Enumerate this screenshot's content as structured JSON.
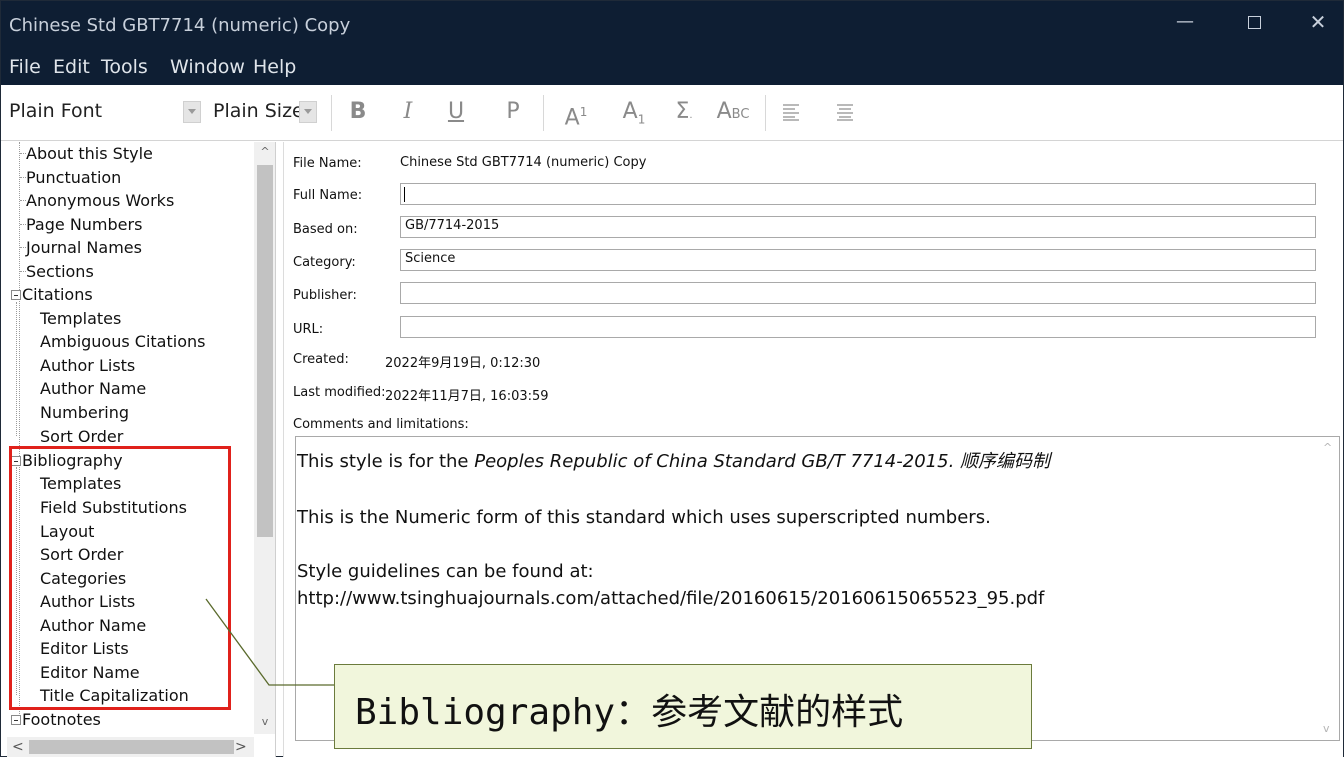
{
  "window": {
    "title": "Chinese Std GBT7714 (numeric) Copy",
    "controls": {
      "minimize": "—",
      "close": "✕"
    }
  },
  "menu": [
    "File",
    "Edit",
    "Tools",
    "Window",
    "Help"
  ],
  "toolbar": {
    "font_combo": "Plain Font",
    "size_combo": "Plain Size",
    "bold": "B",
    "italic": "I",
    "underline": "U",
    "plain": "P",
    "superscript_base": "A",
    "superscript_mark": "1",
    "subscript_base": "A",
    "subscript_mark": "1",
    "symbol": "Σ",
    "small_caps_a": "A",
    "small_caps_bc": "BC",
    "align_left_icon": "align-left-icon",
    "align_center_icon": "align-center-icon"
  },
  "tree": {
    "top_items": [
      "About this Style",
      "Punctuation",
      "Anonymous Works",
      "Page Numbers",
      "Journal Names",
      "Sections"
    ],
    "citations": {
      "label": "Citations",
      "children": [
        "Templates",
        "Ambiguous Citations",
        "Author Lists",
        "Author Name",
        "Numbering",
        "Sort Order"
      ]
    },
    "bibliography": {
      "label": "Bibliography",
      "children": [
        "Templates",
        "Field Substitutions",
        "Layout",
        "Sort Order",
        "Categories",
        "Author Lists",
        "Author Name",
        "Editor Lists",
        "Editor Name",
        "Title Capitalization"
      ]
    },
    "footnotes": {
      "label": "Footnotes"
    },
    "scroll_up": "^",
    "scroll_down": "v",
    "scroll_left": "<",
    "scroll_right": ">"
  },
  "form": {
    "file_name_label": "File Name:",
    "file_name_value": "Chinese Std GBT7714 (numeric) Copy",
    "full_name_label": "Full Name:",
    "full_name_value": "",
    "based_on_label": "Based on:",
    "based_on_value": "GB/7714-2015",
    "category_label": "Category:",
    "category_value": "Science",
    "publisher_label": "Publisher:",
    "publisher_value": "",
    "url_label": "URL:",
    "url_value": "",
    "created_label": "Created:",
    "created_value": "2022年9月19日, 0:12:30",
    "modified_label": "Last modified:",
    "modified_value": "2022年11月7日, 16:03:59",
    "comments_label": "Comments and limitations:",
    "comments": {
      "line1_prefix": "This style is for the ",
      "line1_italic": "Peoples Republic of China Standard GB/T 7714-2015. 顺序编码制",
      "line2": "This is the Numeric form of this standard which uses superscripted numbers.",
      "line3": "Style guidelines can be found at:",
      "line4": "http://www.tsinghuajournals.com/attached/file/20160615/20160615065523_95.pdf"
    }
  },
  "annotation": {
    "text": "Bibliography：参考文献的样式",
    "highlight_color": "#e0211b",
    "callout_bg": "#f1f6dc"
  }
}
